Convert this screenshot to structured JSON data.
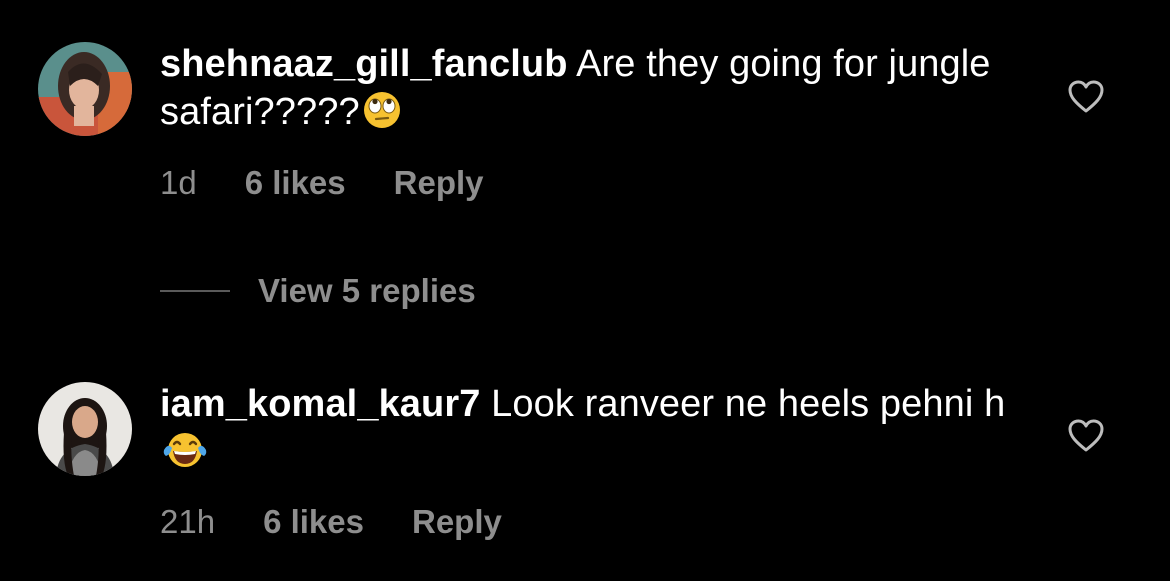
{
  "comments": [
    {
      "username": "shehnaaz_gill_fanclub",
      "text": " Are they going for jungle safari?????",
      "emoji": "face-with-rolling-eyes",
      "time": "1d",
      "likes": "6 likes",
      "reply_label": "Reply"
    },
    {
      "username": "iam_komal_kaur7",
      "text": " Look ranveer ne heels pehni h ",
      "emoji": "face-with-tears-of-joy",
      "time": "21h",
      "likes": "6 likes",
      "reply_label": "Reply"
    }
  ],
  "thread": {
    "view_replies_label": "View 5 replies"
  },
  "colors": {
    "background": "#000000",
    "primary_text": "#ffffff",
    "secondary_text": "#8e8e8e"
  }
}
